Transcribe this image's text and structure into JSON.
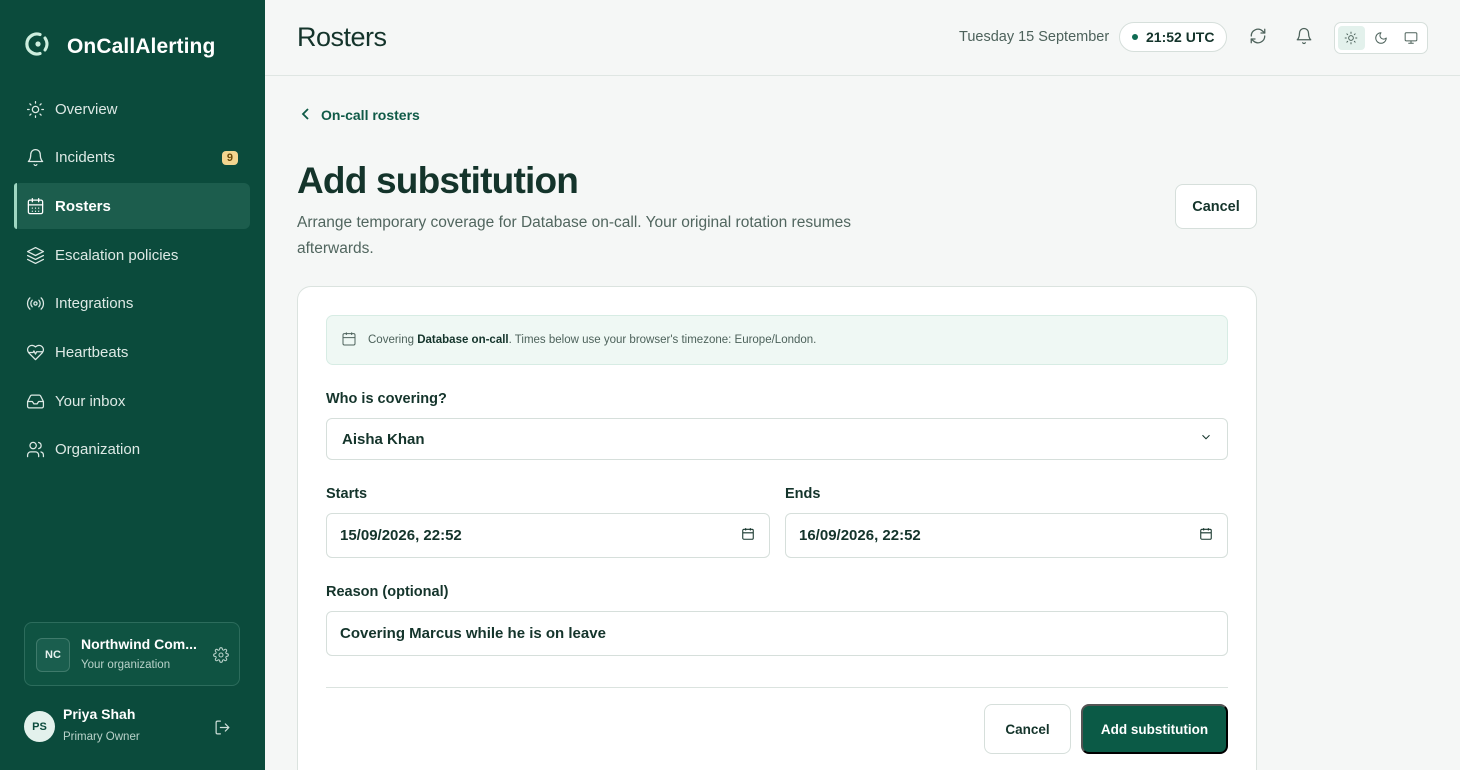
{
  "app": {
    "name": "OnCallAlerting",
    "accent": "#0b4b3c"
  },
  "sidebar": {
    "items": [
      {
        "label": "Overview",
        "icon": "sun-icon"
      },
      {
        "label": "Incidents",
        "icon": "bell-icon",
        "badge": "9"
      },
      {
        "label": "Rosters",
        "icon": "calendar-icon",
        "active": true
      },
      {
        "label": "Escalation policies",
        "icon": "layers-icon"
      },
      {
        "label": "Integrations",
        "icon": "broadcast-icon"
      },
      {
        "label": "Heartbeats",
        "icon": "heart-pulse-icon"
      },
      {
        "label": "Your inbox",
        "icon": "inbox-icon"
      },
      {
        "label": "Organization",
        "icon": "users-icon"
      }
    ],
    "org": {
      "initials": "NC",
      "name": "Northwind Com...",
      "subtitle": "Your organization"
    },
    "user": {
      "initials": "PS",
      "name": "Priya Shah",
      "role": "Primary Owner"
    }
  },
  "header": {
    "title": "Rosters",
    "date": "Tuesday 15 September",
    "time": "21:52 UTC",
    "theme_selected": "light"
  },
  "main": {
    "breadcrumb": "On-call rosters",
    "title": "Add substitution",
    "subtitle": "Arrange temporary coverage for Database on-call. Your original rotation resumes afterwards.",
    "cancel_label": "Cancel",
    "info": {
      "prefix": "Covering ",
      "roster": "Database on-call",
      "suffix": ". Times below use your browser's timezone: Europe/London."
    },
    "form": {
      "who_label": "Who is covering?",
      "who_value": "Aisha Khan",
      "starts_label": "Starts",
      "starts_value": "15/09/2026, 22:52",
      "ends_label": "Ends",
      "ends_value": "16/09/2026, 22:52",
      "reason_label": "Reason (optional)",
      "reason_value": "Covering Marcus while he is on leave"
    },
    "footer": {
      "cancel_label": "Cancel",
      "submit_label": "Add substitution"
    }
  }
}
